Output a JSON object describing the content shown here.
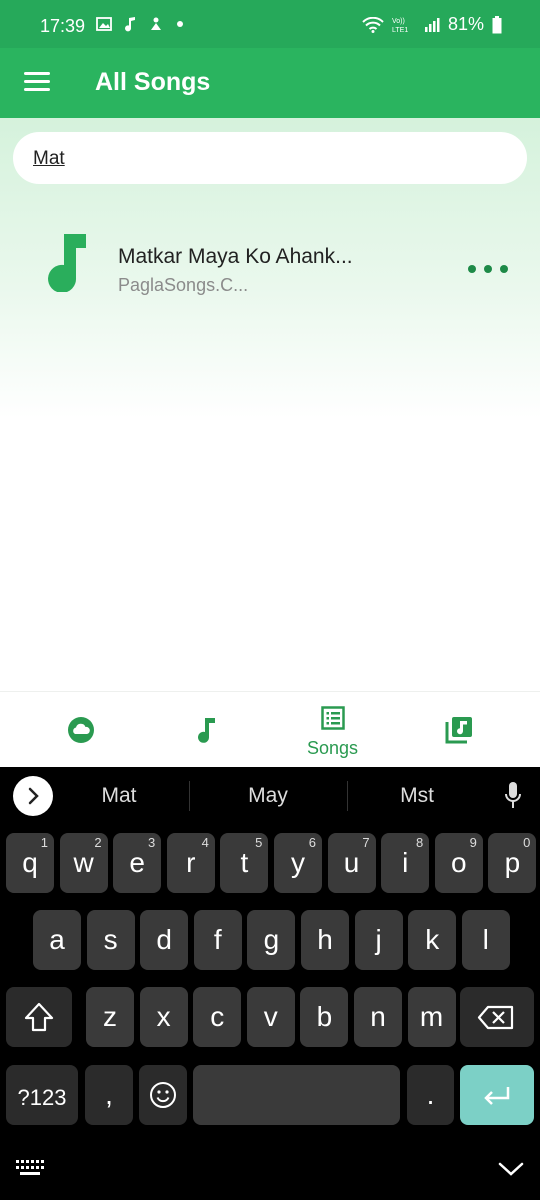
{
  "status_bar": {
    "time": "17:39",
    "notification_icons": [
      "image-icon",
      "music-note-icon",
      "alert-icon",
      "dot-icon"
    ],
    "right_icons": [
      "wifi-icon",
      "volte-icon",
      "signal-icon",
      "battery-icon"
    ],
    "volte_label": "Vo))\nLTE1",
    "battery_percent": "81%"
  },
  "app_bar": {
    "title": "All Songs"
  },
  "search": {
    "value": "Mat"
  },
  "songs": [
    {
      "title": "Matkar Maya Ko Ahank...",
      "subtitle": "PaglaSongs.C..."
    }
  ],
  "bottom_nav": {
    "items": [
      {
        "icon": "cloud-icon",
        "label": ""
      },
      {
        "icon": "music-note-icon",
        "label": ""
      },
      {
        "icon": "song-list-icon",
        "label": "Songs",
        "active": true
      },
      {
        "icon": "playlist-icon",
        "label": ""
      }
    ]
  },
  "keyboard": {
    "suggestions": [
      "Mat",
      "May",
      "Mst"
    ],
    "row1": [
      {
        "key": "q",
        "hint": "1"
      },
      {
        "key": "w",
        "hint": "2"
      },
      {
        "key": "e",
        "hint": "3"
      },
      {
        "key": "r",
        "hint": "4"
      },
      {
        "key": "t",
        "hint": "5"
      },
      {
        "key": "y",
        "hint": "6"
      },
      {
        "key": "u",
        "hint": "7"
      },
      {
        "key": "i",
        "hint": "8"
      },
      {
        "key": "o",
        "hint": "9"
      },
      {
        "key": "p",
        "hint": "0"
      }
    ],
    "row2": [
      "a",
      "s",
      "d",
      "f",
      "g",
      "h",
      "j",
      "k",
      "l"
    ],
    "row3": [
      "z",
      "x",
      "c",
      "v",
      "b",
      "n",
      "m"
    ],
    "symbols_key": "?123",
    "comma_key": ",",
    "period_key": ".",
    "colors": {
      "key": "#3a3a3a",
      "function_key": "#2b2b2b",
      "enter_key": "#7cd0c6",
      "background": "#000000"
    }
  },
  "colors": {
    "status_bar": "#26a95a",
    "app_bar": "#2ab45f",
    "accent": "#1d8a47",
    "subtitle": "#8b8b8b"
  }
}
